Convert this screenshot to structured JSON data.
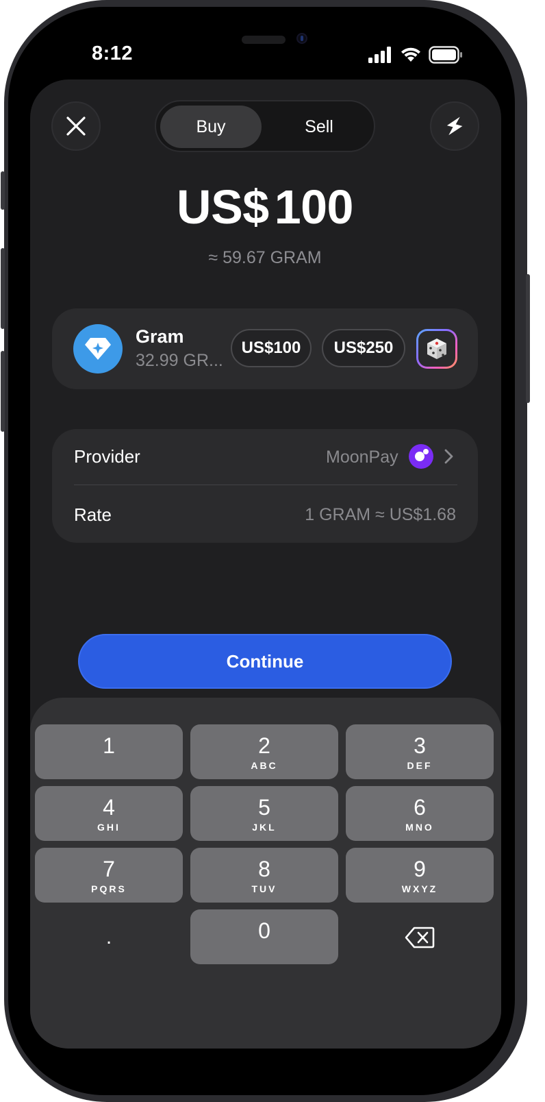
{
  "status_bar": {
    "time": "8:12",
    "icons": [
      "cellular-signal-icon",
      "wifi-icon",
      "battery-icon"
    ]
  },
  "header": {
    "close_icon": "close-icon",
    "flash_icon": "lightning-icon",
    "tabs": [
      {
        "label": "Buy",
        "selected": true
      },
      {
        "label": "Sell",
        "selected": false
      }
    ]
  },
  "amount": {
    "currency": "US$",
    "value": "100",
    "converted": "≈ 59.67 GRAM"
  },
  "asset": {
    "name": "Gram",
    "balance": "32.99 GRAM",
    "icon": "gem-icon",
    "presets": [
      "US$100",
      "US$250"
    ],
    "random_icon": "dice-icon"
  },
  "details": {
    "provider_label": "Provider",
    "provider_value": "MoonPay",
    "rate_label": "Rate",
    "rate_value": "1 GRAM ≈ US$1.68"
  },
  "continue_label": "Continue",
  "keypad": {
    "keys": [
      {
        "num": "1",
        "letters": ""
      },
      {
        "num": "2",
        "letters": "ABC"
      },
      {
        "num": "3",
        "letters": "DEF"
      },
      {
        "num": "4",
        "letters": "GHI"
      },
      {
        "num": "5",
        "letters": "JKL"
      },
      {
        "num": "6",
        "letters": "MNO"
      },
      {
        "num": "7",
        "letters": "PQRS"
      },
      {
        "num": "8",
        "letters": "TUV"
      },
      {
        "num": "9",
        "letters": "WXYZ"
      },
      {
        "num": "0",
        "letters": ""
      }
    ],
    "decimal": ".",
    "backspace_icon": "backspace-icon"
  },
  "colors": {
    "accent": "#2b5de2",
    "sheet": "#1f1f21",
    "card": "#2b2b2d",
    "key": "#6f6f72",
    "gram": "#3d9ae8",
    "moonpay": "#7a2cf5"
  }
}
